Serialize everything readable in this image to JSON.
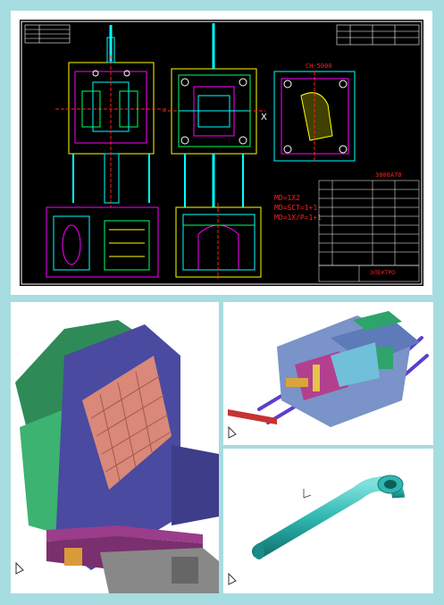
{
  "cad_drawing": {
    "title_label": "CH-5000",
    "model_label": "3000A70",
    "notes": [
      "MD=1X2",
      "MD=SCT=1+1",
      "MD=1X/P=1+1"
    ],
    "company": "ЭЛЕКТРО",
    "colors": {
      "background": "#000000",
      "cyan": "#00ffff",
      "magenta": "#ff00ff",
      "yellow": "#ffff00",
      "red": "#ff2020",
      "green": "#00ff66",
      "white": "#ffffff"
    }
  },
  "panels": {
    "mold_closeup": {
      "icon": "3d-mold-render"
    },
    "mold_assembly": {
      "icon": "3d-assembly-render"
    },
    "pipe_part": {
      "icon": "bent-pipe-render"
    }
  },
  "frame_color": "#a6dde0"
}
